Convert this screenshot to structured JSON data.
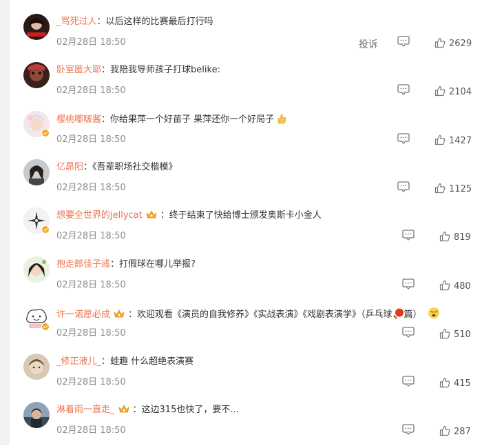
{
  "comments": [
    {
      "user": "_骂死过人",
      "text": "以后这样的比赛最后打行吗",
      "time": "02月28日 18:50",
      "likes": "2629",
      "report": "投诉"
    },
    {
      "user": "卧室匿大耶",
      "text": "我陪我导师孩子打球belike:",
      "time": "02月28日 18:50",
      "likes": "2104"
    },
    {
      "user": "樱桃嘟啵酱",
      "text": "你给果萍一个好苗子 果萍还你一个好局子",
      "time": "02月28日 18:50",
      "likes": "1427",
      "emoji": "thumbs-up-emoji"
    },
    {
      "user": "亿昴阳",
      "text": "《吾辈职场社交楷模》",
      "time": "02月28日 18:50",
      "likes": "1125"
    },
    {
      "user": "想要全世界的jellycat",
      "text": "终于结束了快给博士颁发奥斯卡小金人",
      "time": "02月28日 18:50",
      "likes": "819",
      "badge": "crown-badge"
    },
    {
      "user": "抱走郎佳子彧",
      "text": "打假球在哪儿举报?",
      "time": "02月28日 18:50",
      "likes": "480"
    },
    {
      "user": "许一诺愿必成",
      "text": "欢迎观看《演员的自我修养》《实战表演》《戏剧表演学》（乒乓球",
      "text2": "篇）",
      "time": "02月28日 18:50",
      "likes": "510",
      "badge": "crown-badge",
      "emoji": "ping-pong-emoji",
      "emoji2": "sweat-emoji"
    },
    {
      "user": "_修正液儿_",
      "text": "蛙趣 什么超绝表演赛",
      "time": "02月28日 18:50",
      "likes": "415"
    },
    {
      "user": "淋着雨一直走_",
      "text": "这边315也快了，要不...",
      "time": "02月28日 18:50",
      "likes": "287",
      "badge": "crown-badge"
    }
  ],
  "colors": {
    "username": "#eb7350",
    "text": "#333333",
    "time": "#8c8c8c",
    "badge": "#f5a623"
  }
}
